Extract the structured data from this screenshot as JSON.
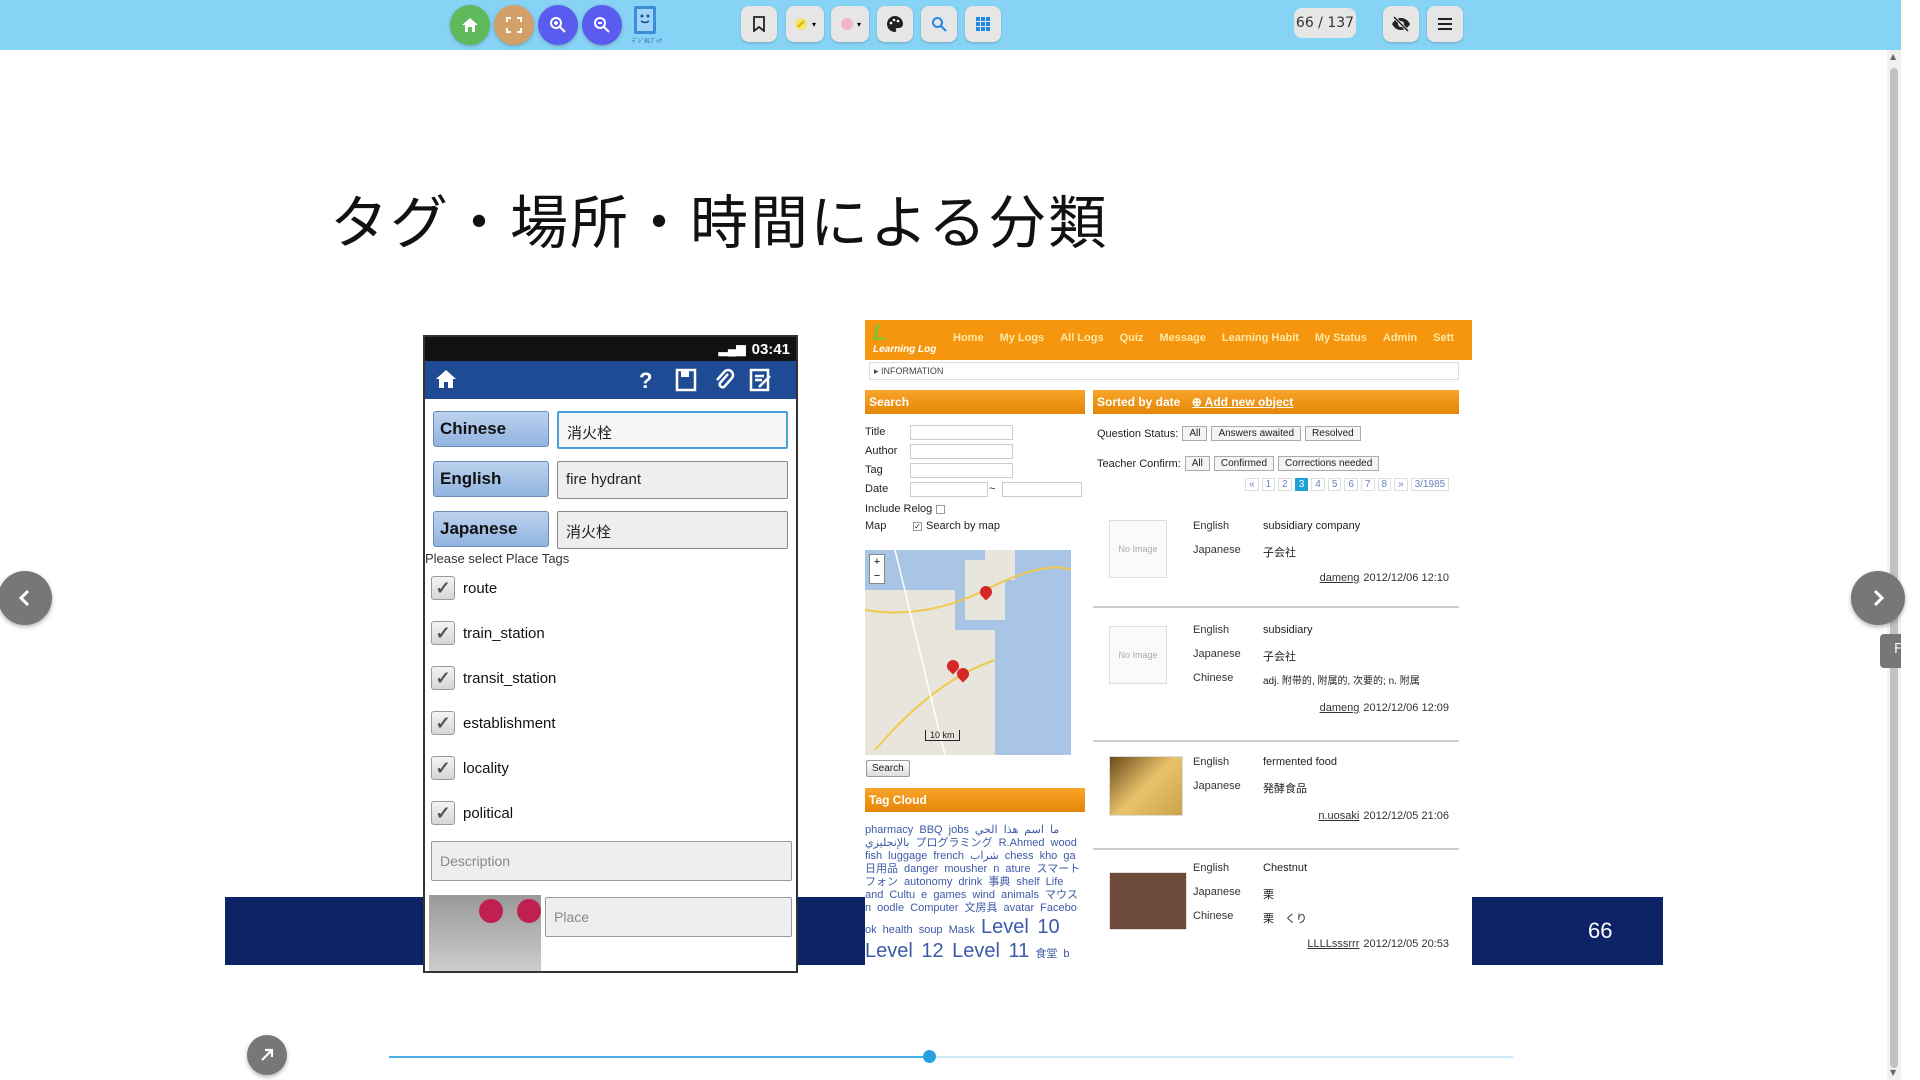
{
  "toolbar": {
    "buttons": [
      {
        "name": "home",
        "color": "#5fb85a"
      },
      {
        "name": "fullscreen",
        "color": "#d4a06a"
      },
      {
        "name": "zoom-in",
        "color": "#5a5cf0"
      },
      {
        "name": "zoom-out",
        "color": "#5a5cf0"
      }
    ],
    "logo_caption": "ﾃﾞｼﾞﾀﾙﾌﾞｯｸ",
    "page_counter": "66 / 137"
  },
  "slide": {
    "title": "タグ・場所・時間による分類",
    "page_number": "66",
    "footer_color": "#0c2466"
  },
  "phone": {
    "time": "03:41",
    "languages": [
      {
        "label": "Chinese",
        "value": "消火栓"
      },
      {
        "label": "English",
        "value": "fire hydrant"
      },
      {
        "label": "Japanese",
        "value": "消火栓"
      }
    ],
    "place_prompt": "Please select Place Tags",
    "tags": [
      "route",
      "train_station",
      "transit_station",
      "establishment",
      "locality",
      "political"
    ],
    "description_placeholder": "Description",
    "place_placeholder": "Place"
  },
  "web": {
    "logo": "Learning Log",
    "menu": [
      "Home",
      "My Logs",
      "All Logs",
      "Quiz",
      "Message",
      "Learning Habit",
      "My Status",
      "Admin",
      "Sett"
    ],
    "breadcrumb": "▸ INFORMATION",
    "search_header": "Search",
    "form_labels": [
      "Title",
      "Author",
      "Tag",
      "Date"
    ],
    "date_sep": "~",
    "include_relog": "Include Relog",
    "map_label": "Map",
    "search_by_map": "Search by map",
    "map_scale": "10 km",
    "search_button": "Search",
    "tagcloud_header": "Tag Cloud",
    "tagcloud_text": "pharmacy BBQ jobs ما اسم هذا الحي بالإنجليزي プログラミング R.Ahmed wood fish luggage french شراب chess kho ga 日用品 danger mousher n ature スマートフォン autonomy drink 事典 shelf Life and Cultu e games wind animals マウス n oodle Computer 文房具 avatar Facebo ok health soup Mask",
    "tagcloud_big": "Level 10 Level 12 Level 11",
    "tagcloud_tail": "食堂 b",
    "sorted_header": "Sorted by date",
    "add_new": "Add new object",
    "question_status_label": "Question Status:",
    "question_status_opts": [
      "All",
      "Answers awaited",
      "Resolved"
    ],
    "teacher_confirm_label": "Teacher Confirm:",
    "teacher_confirm_opts": [
      "All",
      "Confirmed",
      "Corrections needed"
    ],
    "pager": [
      "«",
      "1",
      "2",
      "3",
      "4",
      "5",
      "6",
      "7",
      "8",
      "»",
      "3/1985"
    ],
    "pager_current": "3",
    "entries": [
      {
        "thumb": "No Image",
        "rows": [
          [
            "English",
            "subsidiary company"
          ],
          [
            "Japanese",
            "子会社"
          ]
        ],
        "user": "dameng",
        "date": "2012/12/06 12:10"
      },
      {
        "thumb": "No Image",
        "rows": [
          [
            "English",
            "subsidiary"
          ],
          [
            "Japanese",
            "子会社"
          ],
          [
            "Chinese",
            "adj. 附带的, 附属的, 次要的; n. 附属"
          ]
        ],
        "user": "dameng",
        "date": "2012/12/06 12:09"
      },
      {
        "thumb": "",
        "rows": [
          [
            "English",
            "fermented food"
          ],
          [
            "Japanese",
            "発酵食品"
          ]
        ],
        "user": "n.uosaki",
        "date": "2012/12/05 21:06"
      },
      {
        "thumb": "",
        "rows": [
          [
            "English",
            "Chestnut"
          ],
          [
            "Japanese",
            "栗"
          ],
          [
            "Chinese",
            "栗　くり"
          ]
        ],
        "user": "LLLLsssrrr",
        "date": "2012/12/05 20:53"
      }
    ]
  },
  "navigation": {
    "prev_icon": "chevron-left-icon",
    "next_icon": "chevron-right-icon",
    "side_tab": "F",
    "progress": 0.48
  }
}
